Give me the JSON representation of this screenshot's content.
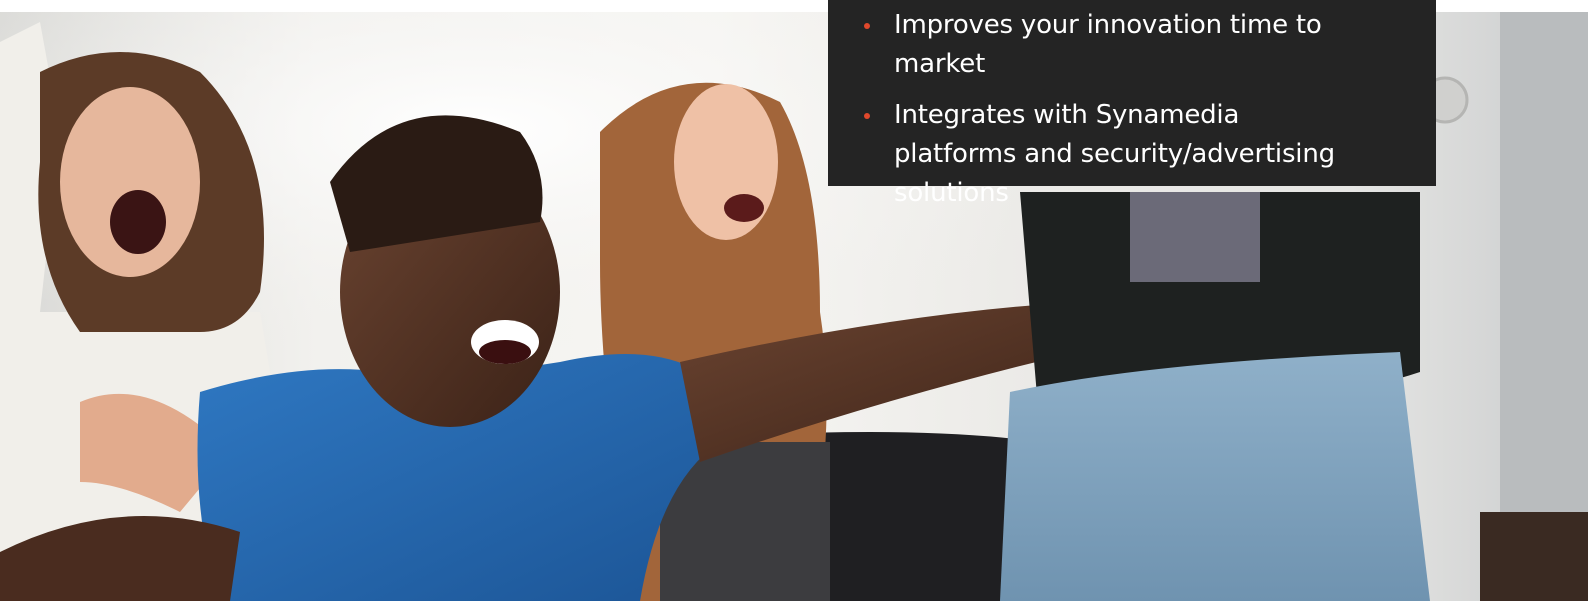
{
  "hero": {
    "image_description_icon": "photo-people-cheering-icon"
  },
  "features": {
    "accent_color": "#e0482c",
    "panel_color": "#242424",
    "items": [
      {
        "text": "Improves your innovation time to market"
      },
      {
        "text": "Integrates with Synamedia platforms and security/advertising solutions"
      }
    ]
  }
}
